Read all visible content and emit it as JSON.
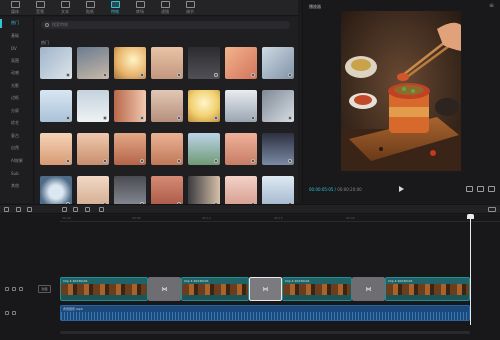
{
  "toolbar": {
    "items": [
      {
        "label": "媒体",
        "icon": "media-icon",
        "active": false
      },
      {
        "label": "音频",
        "icon": "audio-icon",
        "active": false
      },
      {
        "label": "文本",
        "icon": "text-icon",
        "active": false
      },
      {
        "label": "贴纸",
        "icon": "sticker-icon",
        "active": false
      },
      {
        "label": "特效",
        "icon": "effects-icon",
        "active": true
      },
      {
        "label": "转场",
        "icon": "transition-icon",
        "active": false
      },
      {
        "label": "滤镜",
        "icon": "filter-icon",
        "active": false
      },
      {
        "label": "调节",
        "icon": "adjust-icon",
        "active": false
      }
    ]
  },
  "sidebar": {
    "items": [
      {
        "label": "热门",
        "active": true
      },
      {
        "label": "基础",
        "active": false
      },
      {
        "label": "DV",
        "active": false
      },
      {
        "label": "氛围",
        "active": false
      },
      {
        "label": "动感",
        "active": false
      },
      {
        "label": "光影",
        "active": false
      },
      {
        "label": "边框",
        "active": false
      },
      {
        "label": "分屏",
        "active": false
      },
      {
        "label": "综艺",
        "active": false
      },
      {
        "label": "复古",
        "active": false
      },
      {
        "label": "自然",
        "active": false
      },
      {
        "label": "AI效果",
        "active": false
      },
      {
        "label": "Sub",
        "active": false
      },
      {
        "label": "其他",
        "active": false
      }
    ]
  },
  "library": {
    "search_placeholder": "搜索特效",
    "section_title": "热门"
  },
  "player": {
    "title": "播放器",
    "current_time": "00:00:05:05",
    "total_time": "00:00:20:00"
  },
  "timeline": {
    "cover_label": "封面",
    "clip_label": "Clip 4 20230101",
    "audio_label": "背景音乐.mp3",
    "ruler_ticks": [
      "00:00",
      "00:05",
      "00:10",
      "00:15",
      "00:20"
    ],
    "playhead_fraction": 0.93
  },
  "colors": {
    "accent": "#33c3d6",
    "video_track": "#1e6367",
    "audio_track": "#1b4a7a"
  }
}
